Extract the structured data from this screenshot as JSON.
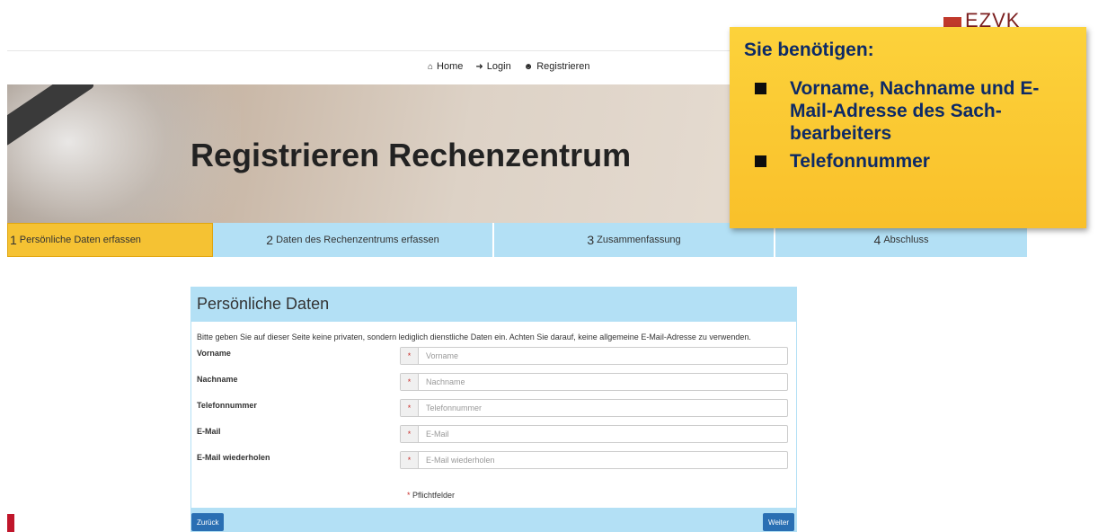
{
  "logo": {
    "text": "EZVK"
  },
  "topnav": {
    "items": [
      {
        "icon": "home-icon",
        "label": "Home"
      },
      {
        "icon": "login-icon",
        "label": "Login"
      },
      {
        "icon": "add-user-icon",
        "label": "Registrieren"
      }
    ]
  },
  "hero": {
    "title": "Registrieren Rechenzentrum"
  },
  "steps": [
    {
      "num": "1",
      "label": "Persönliche Daten erfassen",
      "active": true
    },
    {
      "num": "2",
      "label": "Daten des Rechenzentrums erfassen",
      "active": false
    },
    {
      "num": "3",
      "label": "Zusammenfassung",
      "active": false
    },
    {
      "num": "4",
      "label": "Abschluss",
      "active": false
    }
  ],
  "callout": {
    "heading": "Sie benötigen:",
    "items": [
      "Vorname, Nachname und E-Mail-Adresse des Sach-bearbeiters",
      "Telefonnummer"
    ]
  },
  "panel": {
    "title": "Persönliche Daten",
    "info": "Bitte geben Sie auf dieser Seite keine privaten, sondern lediglich dienstliche Daten ein. Achten Sie darauf, keine allgemeine E-Mail-Adresse zu verwenden.",
    "fields": [
      {
        "label": "Vorname",
        "placeholder": "Vorname",
        "value": ""
      },
      {
        "label": "Nachname",
        "placeholder": "Nachname",
        "value": ""
      },
      {
        "label": "Telefonnummer",
        "placeholder": "Telefonnummer",
        "value": ""
      },
      {
        "label": "E-Mail",
        "placeholder": "E-Mail",
        "value": ""
      },
      {
        "label": "E-Mail wiederholen",
        "placeholder": "E-Mail wiederholen",
        "value": ""
      }
    ],
    "required_marker": "*",
    "required_note": "Pflichtfelder",
    "back_label": "Zurück",
    "next_label": "Weiter"
  },
  "colors": {
    "accent_blue": "#b3e0f5",
    "active_step": "#f5c233",
    "button": "#2a6fb3",
    "callout_bg": "#fcd23b",
    "callout_text": "#0d2a66"
  }
}
